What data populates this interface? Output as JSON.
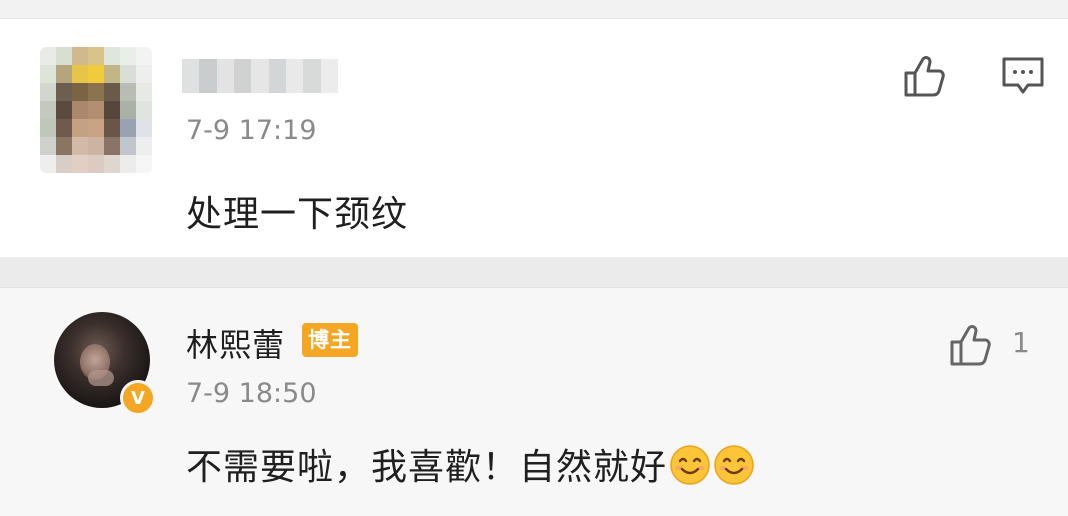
{
  "comment": {
    "timestamp": "7-9 17:19",
    "text": "处理一下颈纹"
  },
  "reply": {
    "username": "林熙蕾",
    "badge": "博主",
    "verified_mark": "V",
    "timestamp": "7-9 18:50",
    "text": "不需要啦，我喜歡！自然就好",
    "like_count": "1",
    "emojis": [
      "smile-emoji",
      "smile-emoji"
    ]
  },
  "colors": {
    "accent": "#f5a623",
    "secondary_text": "#8a8a8a",
    "primary_text": "#1f1f1f"
  },
  "icons": {
    "like": "thumbs-up-icon",
    "comment": "comment-icon"
  }
}
